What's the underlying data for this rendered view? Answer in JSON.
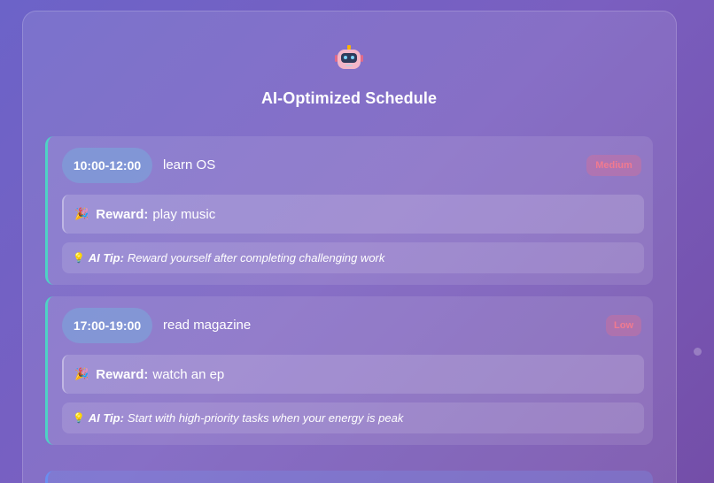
{
  "header": {
    "icon": "robot-icon",
    "title": "AI-Optimized Schedule"
  },
  "schedule": [
    {
      "time": "10:00-12:00",
      "task": "learn OS",
      "priority": "Medium",
      "reward_label": "Reward:",
      "reward": "play music",
      "tip_label": "AI Tip:",
      "tip": "Reward yourself after completing challenging work"
    },
    {
      "time": "17:00-19:00",
      "task": "read magazine",
      "priority": "Low",
      "reward_label": "Reward:",
      "reward": "watch an ep",
      "tip_label": "AI Tip:",
      "tip": "Start with high-priority tasks when your energy is peak"
    }
  ],
  "colors": {
    "accent": "#4fd1c5",
    "priority_text": "#f07a90",
    "background_start": "#6c63c8",
    "background_end": "#744ea8"
  },
  "icons": {
    "reward": "party-popper-icon",
    "tip": "lightbulb-icon"
  }
}
